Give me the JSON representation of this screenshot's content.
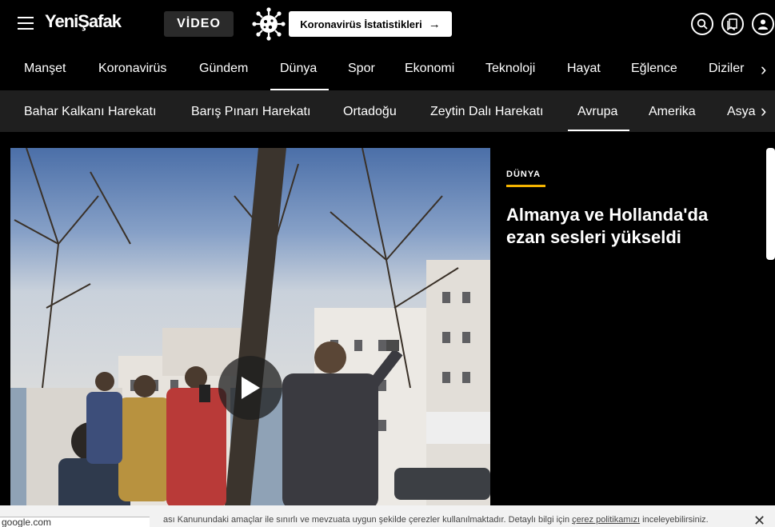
{
  "header": {
    "logo": "YeniŞafak",
    "video_label": "VİDEO",
    "covid_label": "Koronavirüs İstatistikleri",
    "icons": [
      "menu-icon",
      "virus-icon",
      "search-icon",
      "bookmark-icon",
      "user-icon"
    ]
  },
  "main_nav": {
    "items": [
      "Manşet",
      "Koronavirüs",
      "Gündem",
      "Dünya",
      "Spor",
      "Ekonomi",
      "Teknoloji",
      "Hayat",
      "Eğlence",
      "Diziler"
    ],
    "active": "Dünya"
  },
  "sub_nav": {
    "items": [
      "Bahar Kalkanı Harekatı",
      "Barış Pınarı Harekatı",
      "Ortadoğu",
      "Zeytin Dalı Harekatı",
      "Avrupa",
      "Amerika",
      "Asya"
    ],
    "active": "Avrupa"
  },
  "article": {
    "category": "DÜNYA",
    "headline": "Almanya ve Hollanda'da ezan sesleri yükseldi"
  },
  "cookie": {
    "text_before": "ası Kanunundaki amaçlar ile sınırlı ve mevzuata uygun şekilde çerezler kullanılmaktadır. Detaylı bilgi için ",
    "link": "çerez politikamızı",
    "text_after": " inceleyebilirsiniz."
  },
  "status_url": "google.com",
  "colors": {
    "accent": "#f4b400",
    "background": "#000000",
    "subnav": "#1f1f1f"
  }
}
